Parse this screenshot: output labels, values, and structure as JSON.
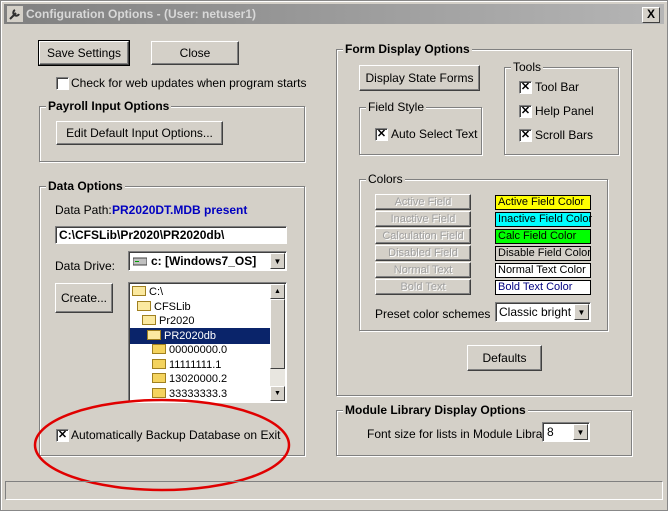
{
  "window": {
    "title": "Configuration Options - (User: netuser1)",
    "close_label": "X"
  },
  "top": {
    "save_settings": "Save Settings",
    "close": "Close",
    "check_updates_label": "Check for web updates when program starts",
    "check_updates_checked": false
  },
  "payroll": {
    "title": "Payroll Input Options",
    "edit_button": "Edit Default Input Options..."
  },
  "data": {
    "title": "Data Options",
    "path_label": "Data Path:",
    "path_status": "PR2020DT.MDB present",
    "path_value": "C:\\CFSLib\\Pr2020\\PR2020db\\",
    "drive_label": "Data Drive:",
    "drive_value": "c: [Windows7_OS]",
    "create_button": "Create...",
    "dirs": [
      {
        "name": "C:\\",
        "indent": 0,
        "selected": false
      },
      {
        "name": "CFSLib",
        "indent": 1,
        "selected": false
      },
      {
        "name": "Pr2020",
        "indent": 2,
        "selected": false
      },
      {
        "name": "PR2020db",
        "indent": 3,
        "selected": true
      },
      {
        "name": "00000000.0",
        "indent": 4,
        "selected": false
      },
      {
        "name": "11111111.1",
        "indent": 4,
        "selected": false
      },
      {
        "name": "13020000.2",
        "indent": 4,
        "selected": false
      },
      {
        "name": "33333333.3",
        "indent": 4,
        "selected": false
      }
    ],
    "auto_backup_label": "Automatically Backup Database on Exit",
    "auto_backup_checked": true
  },
  "form": {
    "title": "Form Display Options",
    "display_state_forms": "Display State Forms",
    "field_style_title": "Field Style",
    "auto_select_label": "Auto Select Text",
    "auto_select_checked": true,
    "tools_title": "Tools",
    "tools": [
      {
        "label": "Tool Bar",
        "checked": true
      },
      {
        "label": "Help Panel",
        "checked": true
      },
      {
        "label": "Scroll Bars",
        "checked": true
      }
    ],
    "colors_title": "Colors",
    "color_buttons": [
      "Active Field",
      "Inactive Field",
      "Calculation Field",
      "Disabled Field",
      "Normal Text",
      "Bold Text"
    ],
    "swatches": [
      {
        "label": "Active Field Color",
        "bg": "#ffff00",
        "fg": "#000000"
      },
      {
        "label": "Inactive Field Color",
        "bg": "#00ffff",
        "fg": "#000000"
      },
      {
        "label": "Calc Field Color",
        "bg": "#00ff00",
        "fg": "#000000"
      },
      {
        "label": "Disable Field Color",
        "bg": "#d4d0c8",
        "fg": "#000000"
      },
      {
        "label": "Normal Text Color",
        "bg": "#ffffff",
        "fg": "#000000"
      },
      {
        "label": "Bold Text Color",
        "bg": "#ffffff",
        "fg": "#000080"
      }
    ],
    "preset_label": "Preset color schemes",
    "preset_value": "Classic bright",
    "defaults_button": "Defaults"
  },
  "module": {
    "title": "Module Library Display Options",
    "font_label": "Font size for lists in Module Library",
    "font_value": "8"
  }
}
